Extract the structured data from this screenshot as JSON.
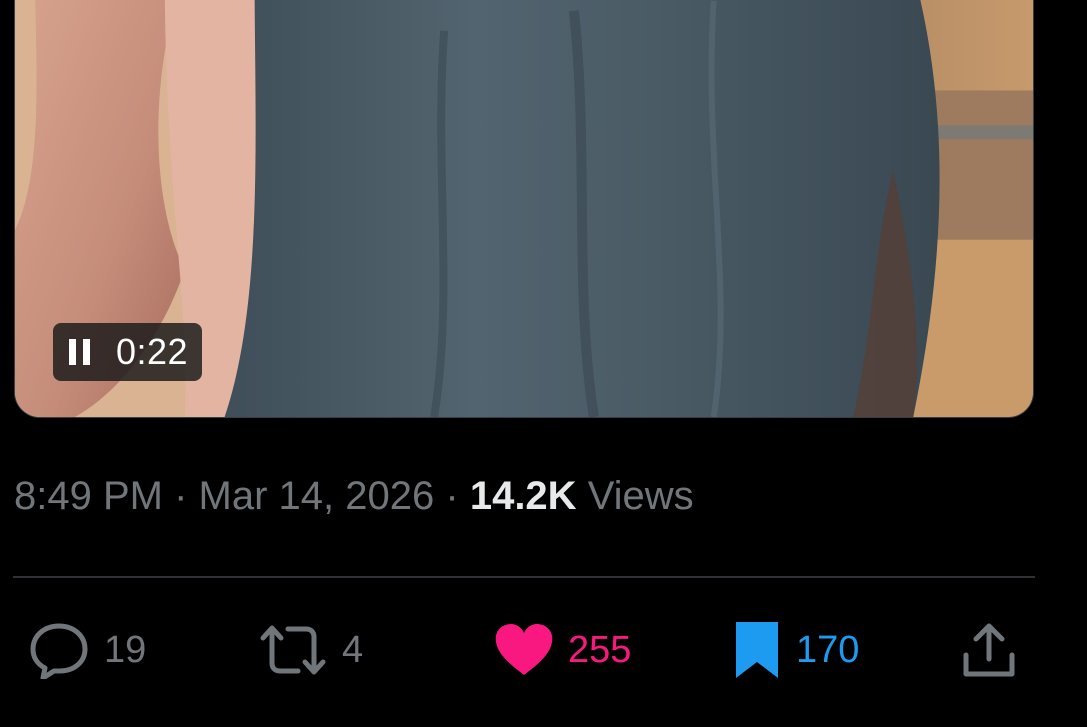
{
  "video": {
    "time": "0:22",
    "control_icon": "pause-icon"
  },
  "meta": {
    "time": "8:49 PM",
    "separator": "·",
    "date": "Mar 14, 2026",
    "views_count": "14.2K",
    "views_label": "Views"
  },
  "actions": {
    "reply": {
      "icon": "reply-icon",
      "count": "19"
    },
    "repost": {
      "icon": "repost-icon",
      "count": "4"
    },
    "like": {
      "icon": "heart-icon",
      "count": "255",
      "active": true
    },
    "bookmark": {
      "icon": "bookmark-icon",
      "count": "170",
      "active": true
    },
    "share": {
      "icon": "share-icon"
    }
  },
  "colors": {
    "like_active": "#f91880",
    "bookmark_active": "#1d9bf0",
    "muted": "#71767b",
    "text": "#e7e9ea"
  }
}
